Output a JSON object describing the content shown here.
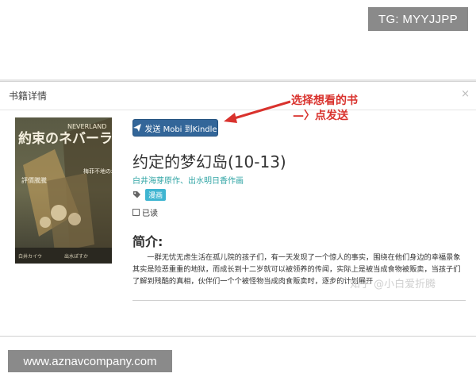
{
  "watermark_top": "TG: MYYJJPP",
  "modal": {
    "title": "书籍详情",
    "close": "×"
  },
  "toolbar": {
    "send_label": "发送 Mobi 到Kindle"
  },
  "annotation": {
    "line1": "选择想看的书",
    "line2": "—〉点发送",
    "color": "#d9322d"
  },
  "book": {
    "title": "约定的梦幻岛(10-13)",
    "authors": "白井海芽原作、出水明日香作画",
    "tag": "漫画",
    "read_label": "已读",
    "cover_title": "約束のネバーランド",
    "cover_logo": "NEVERLAND",
    "cover_side_text": "梅菲不地の地带",
    "cover_left_text": "評價騰騰",
    "cover_author": "白井カイウ",
    "cover_artist": "出水ぽすか"
  },
  "intro": {
    "heading": "简介:",
    "body": "一群无忧无虑生活在孤儿院的孩子们，有一天发现了一个惊人的事实，围绕在他们身边的幸福景象其实是险恶重重的地狱，而成长到十二岁就可以被领养的传闻，实际上是被当成食物被贩卖，当孩子们了解到残酷的真相，伙伴们一个个被怪物当成肉食贩卖时，逐步的计划展开"
  },
  "watermark_zhihu": "知乎 @小白爱折腾",
  "watermark_bottom": "www.aznavcompany.com",
  "colors": {
    "button": "#336699",
    "author_link": "#2fa4a4",
    "tag_bg": "#3fb5d1"
  }
}
